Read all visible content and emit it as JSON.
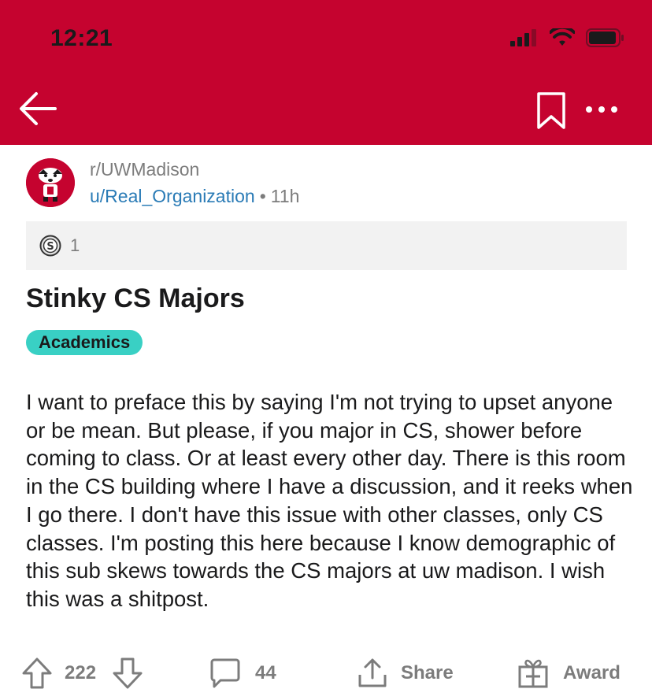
{
  "status_bar": {
    "time": "12:21"
  },
  "header": {
    "back_icon": "arrow-left-icon",
    "bookmark_icon": "bookmark-icon",
    "more_icon": "more-dots-icon",
    "background_color": "#c5032f"
  },
  "post": {
    "subreddit": "r/UWMadison",
    "author": "u/Real_Organization",
    "separator": "•",
    "age": "11h",
    "award_count": "1",
    "title": "Stinky CS Majors",
    "flair": "Academics",
    "flair_color": "#39d0c4",
    "body": "I want to preface this by saying I'm not trying to upset anyone or be mean. But please, if you major in CS, shower before coming to class. Or at least every other day. There is this room in the CS building where I have a discussion, and it reeks when I go there. I don't have this issue with other classes, only CS classes. I'm posting this here because I know demographic of this sub skews towards the CS majors at uw madison. I wish this was a shitpost."
  },
  "actions": {
    "votes": "222",
    "comments": "44",
    "share_label": "Share",
    "award_label": "Award"
  }
}
